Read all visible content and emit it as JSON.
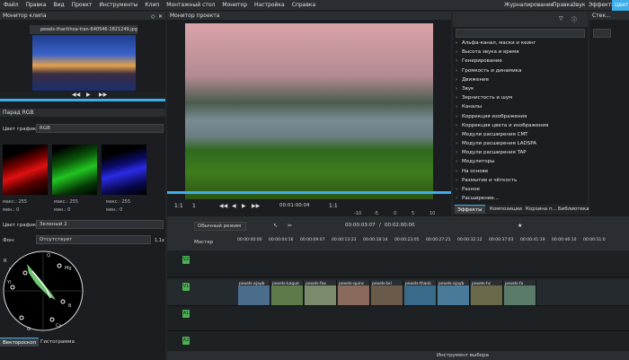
{
  "menu": [
    "Файл",
    "Правка",
    "Вид",
    "Проект",
    "Инструменты",
    "Клип",
    "Монтажный стол",
    "Монитор",
    "Настройка",
    "Справка"
  ],
  "workspaces": [
    "Журналирование",
    "Правка",
    "Звук",
    "Эффекты",
    "Цвет"
  ],
  "clip_monitor": {
    "title": "Монитор клипа",
    "clip_name": "pexels-thanhhoa-tran-640546-1821249.jpg"
  },
  "project_monitor": {
    "title": "Монитор проекта",
    "zoom": "1:1",
    "timecode": "00:01:00:04",
    "fit": "1:1",
    "marks": [
      "-10",
      "-5",
      "0",
      "5",
      "10"
    ],
    "mark_start": "1"
  },
  "rgb_parade": {
    "title": "Парад RGB",
    "graph_label": "Цвет графика:",
    "graph_value": "RGB",
    "readouts": [
      "макс.: 255",
      "макс.: 255",
      "макс.: 255",
      "мин.: 0",
      "мин.: 0",
      "мин.: 0"
    ]
  },
  "vectorscope": {
    "graph_label": "Цвет графика:",
    "graph_value": "Зеленый 2",
    "bg_label": "Фон:",
    "bg_value": "Отсутствует",
    "zoom": "1,1x",
    "markers": [
      "R",
      "Mg",
      "B",
      "Cy",
      "G",
      "Yl",
      "I",
      "Q"
    ],
    "tabs": [
      "Вектороскоп",
      "Гистограмма"
    ]
  },
  "effects": {
    "title": "Эффекты",
    "items": [
      "Альфа-канал, маски и кеинг",
      "Высота звука и время",
      "Генерирование",
      "Громкость и динамика",
      "Движение",
      "Звук",
      "Зернистость и шум",
      "Каналы",
      "Коррекция изображения",
      "Коррекция цвета и изображения",
      "Модули расширения CMT",
      "Модули расширения LADSPA",
      "Модули расширения TAP",
      "Модуляторы",
      "На основе",
      "Размытие и чёткость",
      "Разное",
      "Расширение..."
    ],
    "tabs": [
      "Эффекты",
      "Композиции",
      "Корзина п...",
      "Библиотека"
    ]
  },
  "stack": {
    "title": "Стек..."
  },
  "timeline": {
    "mode": "Обычный режим",
    "position": "00:00:03:07",
    "duration": "00:02:00:00",
    "master": "Мастер",
    "ruler": [
      "00:00:00:00",
      "00:00:04:16",
      "00:00:09:07",
      "00:00:13:23",
      "00:00:18:14",
      "00:00:23:05",
      "00:00:27:21",
      "00:00:32:12",
      "00:00:37:03",
      "00:00:41:19",
      "00:00:46:10",
      "00:00:51:0"
    ],
    "tracks": [
      "V2",
      "V1",
      "A1",
      "A2"
    ],
    "clips": [
      "pexels-ajayb",
      "pexels-kaque",
      "pexels-fox",
      "pexels-quinc",
      "pexels-bri",
      "pexels-thank",
      "pexels-ajayb",
      "pexels-hc",
      "pexels-fo"
    ],
    "status": "Инструмент выбора"
  },
  "colors": {
    "accent": "#3daee9",
    "track_tag": "#4caf50"
  }
}
